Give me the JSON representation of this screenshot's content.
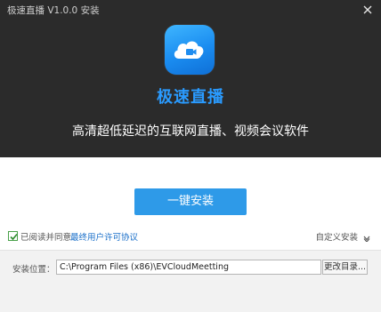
{
  "window": {
    "title": "极速直播 V1.0.0 安装"
  },
  "hero": {
    "logo_icon": "cloud-camera-icon",
    "app_name": "极速直播",
    "slogan": "高清超低延迟的互联网直播、视频会议软件"
  },
  "install": {
    "button_label": "一键安装"
  },
  "agreement": {
    "checked": true,
    "text": "已阅读并同意",
    "link_label": "最终用户许可协议"
  },
  "custom": {
    "label": "自定义安装"
  },
  "path": {
    "label": "安装位置：",
    "value": "C:\\Program Files (x86)\\EVCloudMeetting",
    "browse_label": "更改目录..."
  },
  "colors": {
    "accent": "#2e9ae8",
    "brand_text": "#2a9bff",
    "dark_bg": "#2b2b2b"
  }
}
